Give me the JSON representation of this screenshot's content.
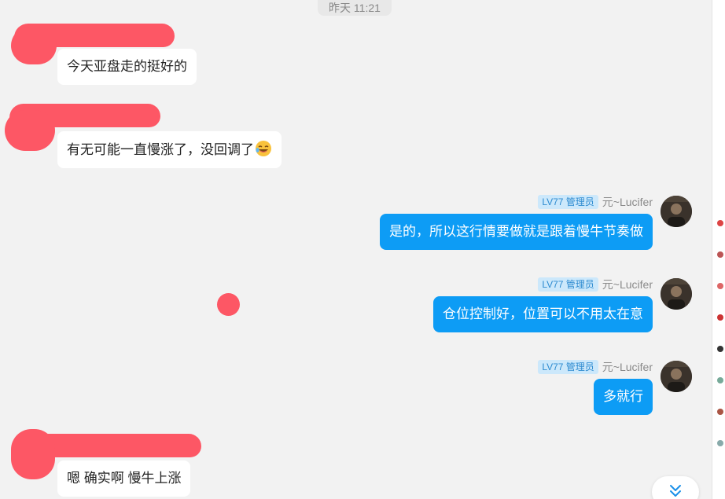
{
  "chat": {
    "timestamp": "昨天 11:21",
    "messages": [
      {
        "direction": "in",
        "text": "今天亚盘走的挺好的"
      },
      {
        "direction": "in",
        "text": "有无可能一直慢涨了，没回调了"
      },
      {
        "direction": "out",
        "badge": "LV77 管理员",
        "sender": "元~Lucifer",
        "text": "是的，所以这行情要做就是跟着慢牛节奏做"
      },
      {
        "direction": "out",
        "badge": "LV77 管理员",
        "sender": "元~Lucifer",
        "text": "仓位控制好，位置可以不用太在意"
      },
      {
        "direction": "out",
        "badge": "LV77 管理员",
        "sender": "元~Lucifer",
        "text": "多就行"
      },
      {
        "direction": "in",
        "text": "嗯 确实啊 慢牛上涨"
      }
    ]
  },
  "icons": {
    "emoji": "laughing-emoji-icon",
    "scroll": "double-chevron-down-icon",
    "avatar": "user-avatar"
  },
  "colors": {
    "background": "#f2f2f2",
    "outgoing_bubble": "#0d9cf5",
    "incoming_bubble": "#ffffff",
    "redaction": "#fd5765",
    "badge_bg": "#cce8fb",
    "badge_text": "#2e8bd0"
  }
}
